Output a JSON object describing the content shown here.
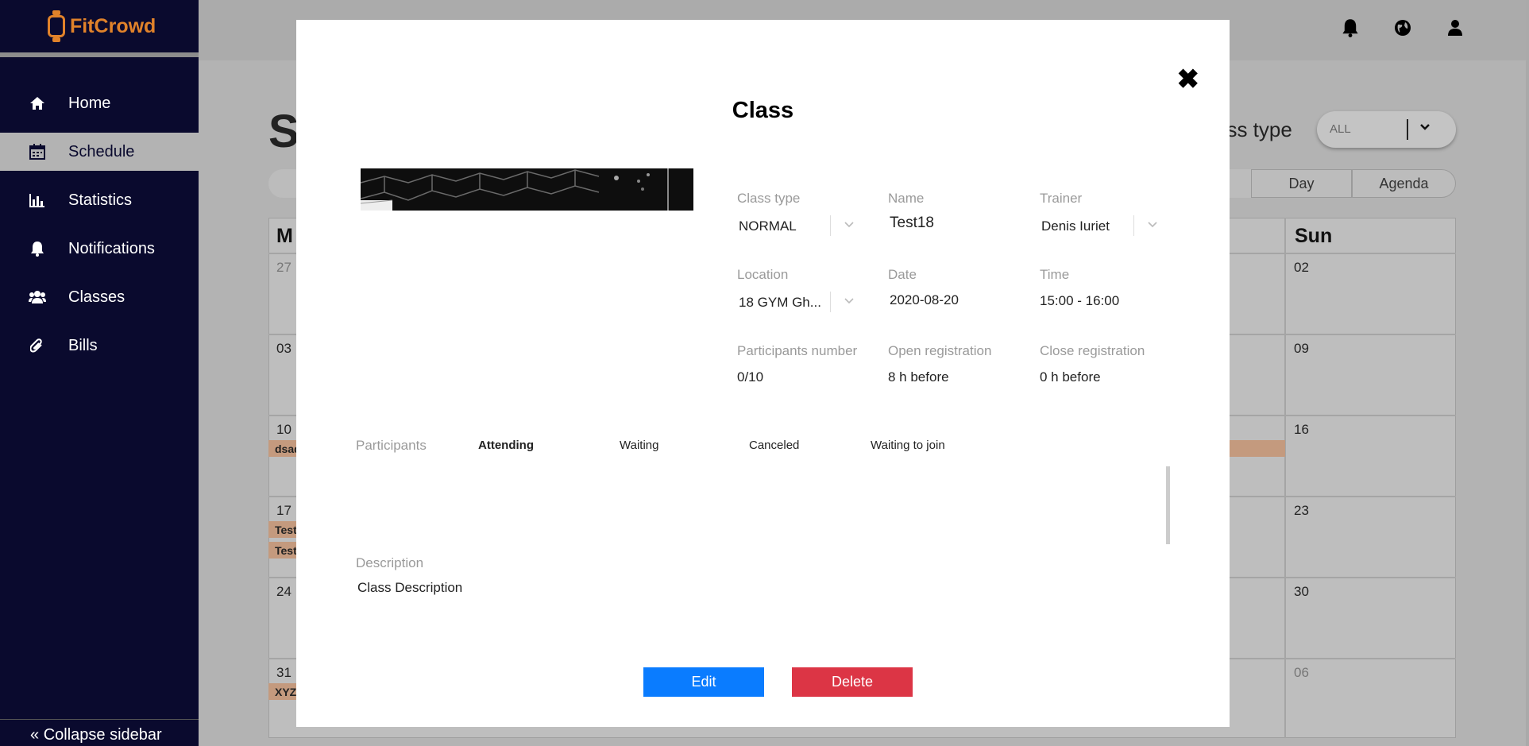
{
  "app": {
    "name": "FitCrowd"
  },
  "sidebar": {
    "items": [
      {
        "label": "Home",
        "icon": "home-icon",
        "active": false
      },
      {
        "label": "Schedule",
        "icon": "calendar-icon",
        "active": true
      },
      {
        "label": "Statistics",
        "icon": "bar-chart-icon",
        "active": false
      },
      {
        "label": "Notifications",
        "icon": "bell-icon",
        "active": false
      },
      {
        "label": "Classes",
        "icon": "users-icon",
        "active": false
      },
      {
        "label": "Bills",
        "icon": "paperclip-icon",
        "active": false
      }
    ],
    "collapse_label": "Collapse sidebar"
  },
  "topbar": {
    "icons": [
      "bell-icon",
      "globe-icon",
      "user-icon"
    ]
  },
  "page": {
    "title_partial": "S",
    "filter_label_partial": "ass type",
    "filter_value": "ALL",
    "view_buttons": [
      "Day",
      "Agenda"
    ],
    "calendar": {
      "headers_visible": [
        "M",
        "Sun"
      ],
      "left_days": [
        "27",
        "03",
        "10",
        "17",
        "24",
        "31"
      ],
      "right_days": [
        "02",
        "09",
        "16",
        "23",
        "30",
        "06"
      ],
      "events_left": [
        "dsad",
        "Test",
        "Test",
        "XYZ"
      ]
    }
  },
  "modal": {
    "title": "Class",
    "fields": {
      "class_type": {
        "label": "Class type",
        "value": "NORMAL"
      },
      "name": {
        "label": "Name",
        "value": "Test18"
      },
      "trainer": {
        "label": "Trainer",
        "value": "Denis Iuriet"
      },
      "location": {
        "label": "Location",
        "value": "18 GYM Gh..."
      },
      "date": {
        "label": "Date",
        "value": "2020-08-20"
      },
      "time": {
        "label": "Time",
        "value": "15:00 - 16:00"
      },
      "participants_number": {
        "label": "Participants number",
        "value": "0/10"
      },
      "open_registration": {
        "label": "Open registration",
        "value": "8 h before"
      },
      "close_registration": {
        "label": "Close registration",
        "value": "0 h before"
      }
    },
    "participants": {
      "label": "Participants",
      "tabs": [
        "Attending",
        "Waiting",
        "Canceled",
        "Waiting to join"
      ],
      "active_tab": "Attending"
    },
    "description": {
      "label": "Description",
      "value": "Class Description"
    },
    "buttons": {
      "edit": "Edit",
      "delete": "Delete"
    }
  },
  "colors": {
    "sidebar_bg": "#0a0a2e",
    "brand": "#e0822a",
    "edit": "#0a7cff",
    "delete": "#dc3545",
    "event": "#c49a7e"
  }
}
